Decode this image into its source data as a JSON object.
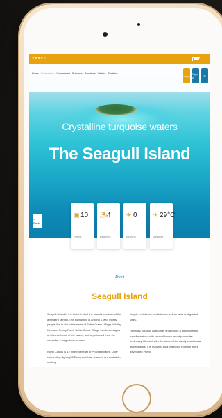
{
  "status_bar": {
    "signal": "●●●●○"
  },
  "nav": {
    "links": [
      {
        "label": "Home"
      },
      {
        "label": "Destinations"
      },
      {
        "label": "Government"
      },
      {
        "label": "Business"
      },
      {
        "label": "Residents"
      },
      {
        "label": "Visitors"
      },
      {
        "label": "Statistics"
      }
    ],
    "buttons": {
      "lang": "Lang",
      "signin": "Sign in",
      "menu": "☰"
    }
  },
  "hero": {
    "tagline": "Crystalline turquoise waters",
    "title": "The Seagull Island",
    "back_label": "< Back"
  },
  "stats": [
    {
      "icon": "hotel-icon",
      "glyph": "▣",
      "value": "10",
      "label": "Hotels"
    },
    {
      "icon": "beach-icon",
      "glyph": "⛱",
      "value": "4",
      "label": "Beaches"
    },
    {
      "icon": "airport-icon",
      "glyph": "✈",
      "value": "0",
      "label": "Airports"
    },
    {
      "icon": "weather-icon",
      "glyph": "☀",
      "value": "29°C",
      "label": "Weather"
    }
  ],
  "about": {
    "label": "About",
    "title": "Seagull Island",
    "left_paragraphs": [
      "Seagull Island is the lushest of all the islands because of the abundant rainfall. The population is around 1,900, mostly people live in the settlements of Bottle Creek Village, Whitby, Kew and Sandy Point. Bottle Creek Village borders a lagoon on the northeast of the island, and is protected from the ocean by a long ribbon of sand.",
      "North Caicos is 12 mile northeast of Providenciales. Daily connecting flights (30 Euro) and boat charters are available, making"
    ],
    "right_paragraphs": [
      "bicycle rentals are available as well as taxis and guided tours.",
      "Recently, Seagull Island has undergone a development transformation, with several luxury resort properties underway. Blessed with the same white sandy beaches as its neighbors, it is evolving as a 'gateway' from the more developed Provo."
    ]
  },
  "colors": {
    "accent": "#e7a20f",
    "link": "#1a78a8",
    "phone_frame": "#e9cfa9"
  }
}
